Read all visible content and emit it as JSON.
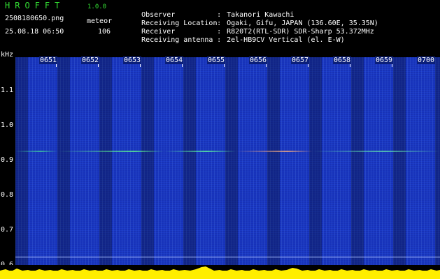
{
  "app": {
    "name": "HROFFT",
    "version": "1.0.0"
  },
  "file_name": "2508180650.png",
  "meteor_label": "meteor",
  "datetime": "25.08.18 06:50",
  "meteor_count": "106",
  "info": [
    {
      "key": "Observer",
      "value": "Takanori Kawachi"
    },
    {
      "key": "Receiving Location",
      "value": "Ogaki, Gifu, JAPAN (136.60E, 35.35N)"
    },
    {
      "key": "Receiver",
      "value": "R820T2(RTL-SDR) SDR-Sharp 53.372MHz"
    },
    {
      "key": "Receiving antenna",
      "value": "2el-HB9CV Vertical (el. E-W)"
    }
  ],
  "axis": {
    "unit": "kHz",
    "time_labels": [
      "0651",
      "0652",
      "0653",
      "0654",
      "0655",
      "0656",
      "0657",
      "0658",
      "0659",
      "0700"
    ],
    "freq_labels": [
      "1.1",
      "1.0",
      "0.9",
      "0.8",
      "0.7",
      "0.6"
    ]
  },
  "colors": {
    "background": "#000000",
    "spectrogram": "#1732b8",
    "header_green": "#33dd33",
    "signal_bar": "#ffee00"
  }
}
